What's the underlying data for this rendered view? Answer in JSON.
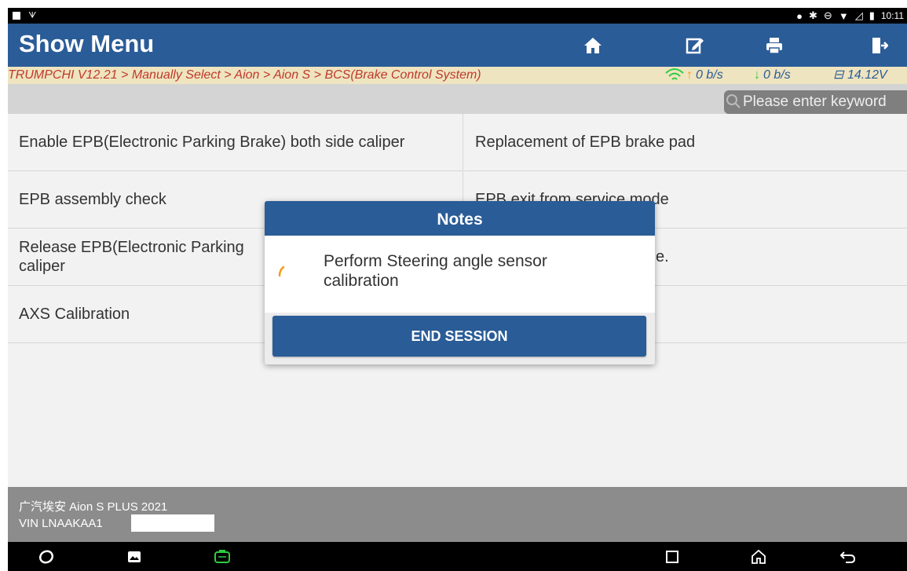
{
  "status_bar": {
    "time": "10:11"
  },
  "header": {
    "title": "Show Menu"
  },
  "toolbar": {
    "icons": [
      "home-icon",
      "edit-icon",
      "print-icon",
      "exit-icon"
    ]
  },
  "breadcrumb": {
    "path": "TRUMPCHI V12.21 > Manually Select > Aion > Aion S > BCS(Brake Control System)",
    "upload_rate": "0 b/s",
    "download_rate": "0 b/s",
    "voltage": "14.12V"
  },
  "search": {
    "placeholder": "Please enter keyword"
  },
  "menu": {
    "items": [
      "Enable EPB(Electronic Parking Brake) both side caliper",
      "Replacement of EPB brake pad",
      "EPB assembly check",
      "EPB exit from service mode",
      "Release EPB(Electronic Parking",
      "e.",
      "AXS Calibration"
    ],
    "item5_line2": "caliper"
  },
  "footer": {
    "vehicle": "广汽埃安 Aion S PLUS 2021",
    "vin": "VIN LNAAKAA1"
  },
  "dialog": {
    "title": "Notes",
    "message": "Perform Steering angle sensor calibration",
    "button": "END SESSION"
  },
  "colors": {
    "header_blue": "#2a5c97",
    "breadcrumb_red": "#c0392b",
    "wifi_green": "#2ecc40"
  }
}
